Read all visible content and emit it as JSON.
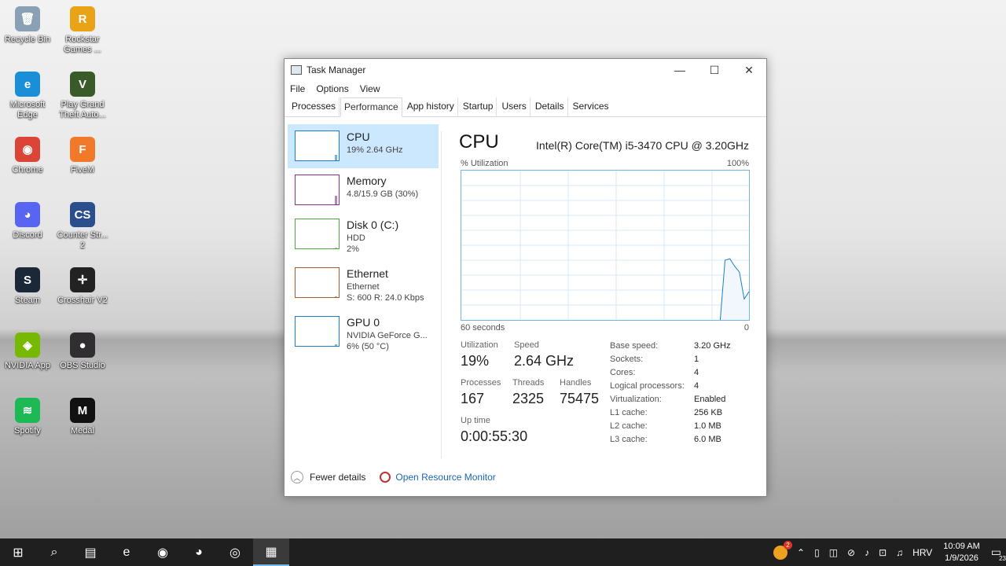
{
  "desktop": {
    "icons": [
      {
        "label": "Recycle Bin",
        "glyph": "🗑",
        "color": "#8aa0b4"
      },
      {
        "label": "Rockstar Games ...",
        "glyph": "R",
        "color": "#e8a317"
      },
      {
        "label": "Microsoft Edge",
        "glyph": "e",
        "color": "#1a8fd8"
      },
      {
        "label": "Play Grand Theft Auto...",
        "glyph": "V",
        "color": "#3a5a2a"
      },
      {
        "label": "Chrome",
        "glyph": "◉",
        "color": "#db4437"
      },
      {
        "label": "FiveM",
        "glyph": "F",
        "color": "#f07a2a"
      },
      {
        "label": "Discord",
        "glyph": "◕",
        "color": "#5865f2"
      },
      {
        "label": "Counter Str... 2",
        "glyph": "CS",
        "color": "#2b4e8c"
      },
      {
        "label": "Steam",
        "glyph": "S",
        "color": "#1b2838"
      },
      {
        "label": "Crosshair V2",
        "glyph": "✛",
        "color": "#222222"
      },
      {
        "label": "NVIDIA App",
        "glyph": "◈",
        "color": "#76b900"
      },
      {
        "label": "OBS Studio",
        "glyph": "●",
        "color": "#302e31"
      },
      {
        "label": "Spotify",
        "glyph": "≋",
        "color": "#1db954"
      },
      {
        "label": "Medal",
        "glyph": "M",
        "color": "#111111"
      }
    ]
  },
  "window": {
    "title": "Task Manager",
    "buttons": {
      "minimize": "—",
      "maximize": "☐",
      "close": "✕"
    },
    "menu": [
      "File",
      "Options",
      "View"
    ],
    "tabs": [
      "Processes",
      "Performance",
      "App history",
      "Startup",
      "Users",
      "Details",
      "Services"
    ],
    "active_tab": "Performance"
  },
  "resources": [
    {
      "name": "CPU",
      "sub1": "19% 2.64 GHz",
      "sub2": "",
      "sub3": "",
      "color": "#1a7fc4",
      "level": 0.19
    },
    {
      "name": "Memory",
      "sub1": "4.8/15.9 GB (30%)",
      "sub2": "",
      "sub3": "",
      "color": "#8b2d8b",
      "level": 0.3
    },
    {
      "name": "Disk 0 (C:)",
      "sub1": "HDD",
      "sub2": "2%",
      "sub3": "",
      "color": "#4da640",
      "level": 0.02
    },
    {
      "name": "Ethernet",
      "sub1": "Ethernet",
      "sub2": "S: 600 R: 24.0 Kbps",
      "sub3": "",
      "color": "#a55a2a",
      "level": 0.0
    },
    {
      "name": "GPU 0",
      "sub1": "NVIDIA GeForce G...",
      "sub2": "6% (50 °C)",
      "sub3": "",
      "color": "#1a7fc4",
      "level": 0.06
    }
  ],
  "detail": {
    "title": "CPU",
    "model": "Intel(R) Core(TM) i5-3470 CPU @ 3.20GHz",
    "util_label": "% Utilization",
    "util_max": "100%",
    "axis_left": "60 seconds",
    "axis_right": "0",
    "stats": {
      "utilization_label": "Utilization",
      "utilization": "19%",
      "speed_label": "Speed",
      "speed": "2.64 GHz",
      "processes_label": "Processes",
      "processes": "167",
      "threads_label": "Threads",
      "threads": "2325",
      "handles_label": "Handles",
      "handles": "75475",
      "uptime_label": "Up time",
      "uptime": "0:00:55:30"
    },
    "specs": [
      {
        "k": "Base speed:",
        "v": "3.20 GHz"
      },
      {
        "k": "Sockets:",
        "v": "1"
      },
      {
        "k": "Cores:",
        "v": "4"
      },
      {
        "k": "Logical processors:",
        "v": "4"
      },
      {
        "k": "Virtualization:",
        "v": "Enabled"
      },
      {
        "k": "L1 cache:",
        "v": "256 KB"
      },
      {
        "k": "L2 cache:",
        "v": "1.0 MB"
      },
      {
        "k": "L3 cache:",
        "v": "6.0 MB"
      }
    ]
  },
  "chart_data": {
    "type": "area",
    "x": [
      0,
      1,
      2,
      3,
      4,
      5,
      6,
      7,
      8,
      9,
      10,
      11,
      12,
      13,
      14,
      15,
      16,
      17,
      18,
      19,
      20,
      21,
      22,
      23,
      24,
      25,
      26,
      27,
      28,
      29,
      30,
      31,
      32,
      33,
      34,
      35,
      36,
      37,
      38,
      39,
      40,
      41,
      42,
      43,
      44,
      45,
      46,
      47,
      48,
      49,
      50,
      51,
      52,
      53,
      54,
      55,
      56,
      57,
      58,
      59,
      60
    ],
    "values": [
      null,
      null,
      null,
      null,
      null,
      null,
      null,
      null,
      null,
      null,
      null,
      null,
      null,
      null,
      null,
      null,
      null,
      null,
      null,
      null,
      null,
      null,
      null,
      null,
      null,
      null,
      null,
      null,
      null,
      null,
      null,
      null,
      null,
      null,
      null,
      null,
      null,
      null,
      null,
      null,
      null,
      null,
      null,
      null,
      null,
      null,
      null,
      null,
      null,
      null,
      null,
      null,
      null,
      null,
      0,
      40,
      41,
      36,
      32,
      14,
      19
    ],
    "ylim": [
      0,
      100
    ],
    "xlabel": "60 seconds",
    "ylabel": "% Utilization"
  },
  "footer": {
    "fewer": "Fewer details",
    "monitor": "Open Resource Monitor"
  },
  "taskbar": {
    "items": [
      "⊞",
      "⌕",
      "▤",
      "e",
      "◉",
      "◕",
      "◎",
      "▦"
    ],
    "tray_lang": "HRV",
    "time": "10:09 AM",
    "date": "1/9/2026",
    "notif_count": "23",
    "badge": "2"
  }
}
